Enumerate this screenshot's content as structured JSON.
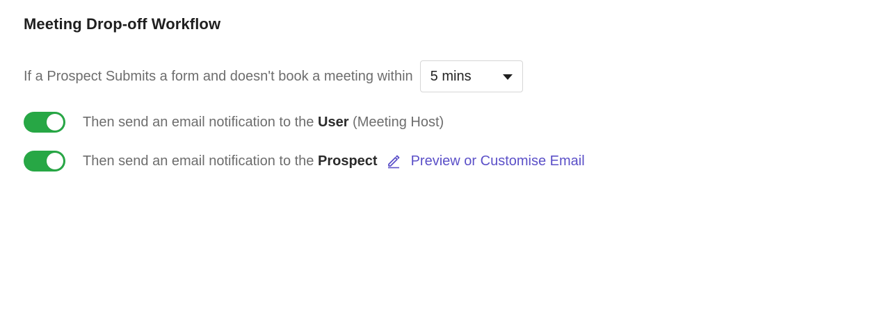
{
  "workflow": {
    "title": "Meeting Drop-off Workflow",
    "condition_text": "If a Prospect Submits a form and doesn't book a meeting within",
    "delay_select": {
      "value": "5 mins"
    }
  },
  "notifications": [
    {
      "enabled": true,
      "prefix": "Then send an email notification to the",
      "recipient": "User",
      "suffix": "(Meeting Host)"
    },
    {
      "enabled": true,
      "prefix": "Then send an email notification to the",
      "recipient": "Prospect",
      "action_icon": "pencil-icon",
      "action_label": "Preview or Customise Email"
    }
  ],
  "colors": {
    "toggle_on": "#27a745",
    "link": "#5b50c8"
  }
}
